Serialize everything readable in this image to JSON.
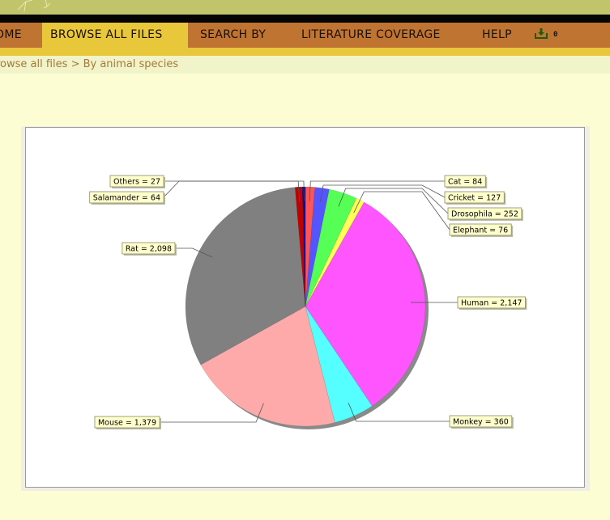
{
  "header": {
    "nav_items": [
      {
        "label": "OME",
        "active": false
      },
      {
        "label": "BROWSE ALL FILES",
        "active": true
      },
      {
        "label": "SEARCH BY",
        "active": false
      },
      {
        "label": "LITERATURE COVERAGE",
        "active": false
      },
      {
        "label": "HELP",
        "active": false
      }
    ],
    "download_icon": "download-tray-icon",
    "download_count": "0"
  },
  "breadcrumb": "rowse all files > By animal species",
  "colors": {
    "banner": "#c1c46b",
    "nav_bg": "#c07432",
    "nav_active": "#e9c73a",
    "page_bg": "#fcfdd3"
  },
  "chart_data": {
    "type": "pie",
    "title": "",
    "start_angle_deg_clockwise_from_top": 0,
    "slices": [
      {
        "label": "Cat",
        "value": 84,
        "display": "Cat = 84",
        "color": "#ff5555"
      },
      {
        "label": "Cricket",
        "value": 127,
        "display": "Cricket = 127",
        "color": "#5555ff"
      },
      {
        "label": "Drosophila",
        "value": 252,
        "display": "Drosophila = 252",
        "color": "#55ff55"
      },
      {
        "label": "Elephant",
        "value": 76,
        "display": "Elephant = 76",
        "color": "#ffff55"
      },
      {
        "label": "Human",
        "value": 2147,
        "display": "Human = 2,147",
        "color": "#ff55ff"
      },
      {
        "label": "Monkey",
        "value": 360,
        "display": "Monkey = 360",
        "color": "#55ffff"
      },
      {
        "label": "Mouse",
        "value": 1379,
        "display": "Mouse = 1,379",
        "color": "#ffaaaa"
      },
      {
        "label": "Rat",
        "value": 2098,
        "display": "Rat = 2,098",
        "color": "#808080"
      },
      {
        "label": "Salamander",
        "value": 64,
        "display": "Salamander = 64",
        "color": "#c00000"
      },
      {
        "label": "Others",
        "value": 27,
        "display": "Others = 27",
        "color": "#000099"
      }
    ]
  }
}
